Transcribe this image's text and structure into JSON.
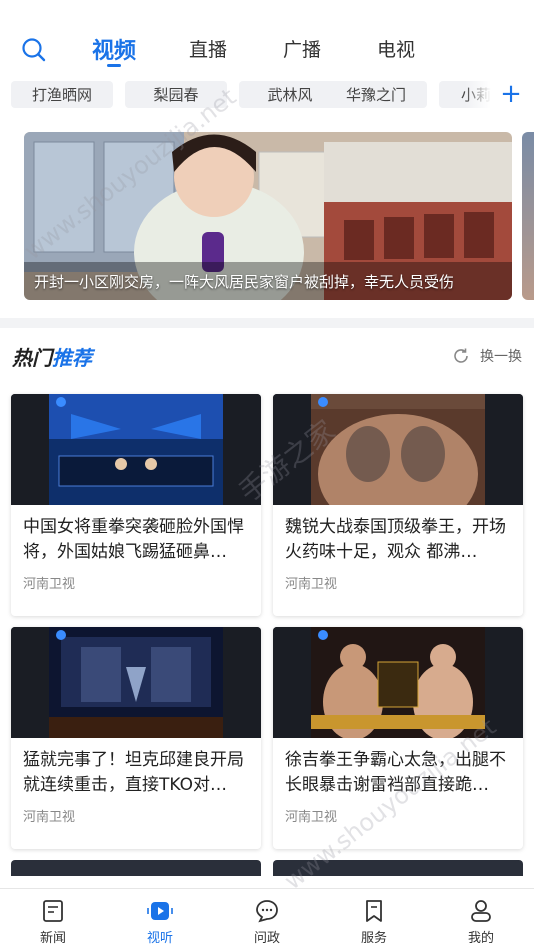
{
  "header": {
    "tabs": [
      {
        "label": "视频",
        "active": true
      },
      {
        "label": "直播",
        "active": false
      },
      {
        "label": "广播",
        "active": false
      },
      {
        "label": "电视",
        "active": false
      }
    ]
  },
  "channels": [
    "打渔晒网",
    "梨园春",
    "武林风",
    "华豫之门",
    "小莉"
  ],
  "banner": {
    "caption": "开封一小区刚交房，一阵大风居民家窗户被刮掉，幸无人员受伤"
  },
  "hot": {
    "title_part1": "热门",
    "title_part2": "推荐",
    "refresh_label": "换一换",
    "videos": [
      {
        "title": "中国女将重拳突袭砸脸外国悍将，外国姑娘飞踢猛砸鼻…",
        "source": "河南卫视"
      },
      {
        "title": "魏锐大战泰国顶级拳王，开场火药味十足，观众 都沸…",
        "source": "河南卫视"
      },
      {
        "title": "猛就完事了！坦克邱建良开局就连续重击，直接TKO对…",
        "source": "河南卫视"
      },
      {
        "title": "徐吉拳王争霸心太急，出腿不长眼暴击谢雷裆部直接跪…",
        "source": "河南卫视"
      }
    ]
  },
  "bottom_nav": [
    {
      "label": "新闻",
      "icon": "news-icon",
      "active": false
    },
    {
      "label": "视听",
      "icon": "video-icon",
      "active": true
    },
    {
      "label": "问政",
      "icon": "chat-icon",
      "active": false
    },
    {
      "label": "服务",
      "icon": "bookmark-icon",
      "active": false
    },
    {
      "label": "我的",
      "icon": "user-icon",
      "active": false
    }
  ],
  "watermarks": [
    "www.shouyouzijia.net",
    "手游之家",
    "www.shouyouzijia.net"
  ],
  "colors": {
    "accent": "#1a73e8",
    "page_bg": "#f2f3f5"
  }
}
